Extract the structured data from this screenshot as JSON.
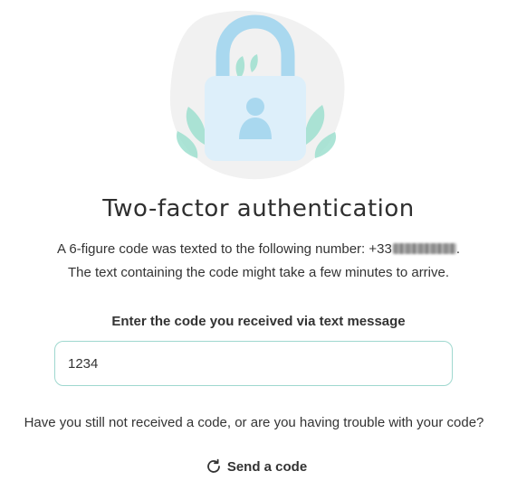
{
  "illustration": {
    "icon": "padlock-user-icon",
    "colors": {
      "blob": "#f1f1f1",
      "shackle": "#a9d8ef",
      "body": "#ddeffa",
      "person": "#a9d8ef",
      "leaves": "#9ee0cf"
    }
  },
  "header": {
    "title": "Two-factor authentication"
  },
  "message": {
    "line1_prefix": "A 6-figure code was texted to the following number: +33",
    "line1_suffix": ".",
    "line2": "The text containing the code might take a few minutes to arrive."
  },
  "code_form": {
    "label": "Enter the code you received via text message",
    "value": "1234",
    "border_color": "#9fd8cf"
  },
  "help": {
    "trouble_text": "Have you still not received a code, or are you having trouble with your code?",
    "send_code_label": "Send a code",
    "send_code_icon": "refresh-icon"
  }
}
